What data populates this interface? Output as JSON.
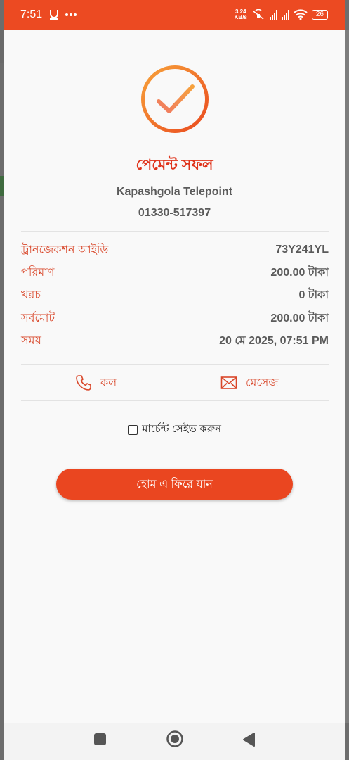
{
  "status_bar": {
    "time": "7:51",
    "left_icons": [
      "usb-icon",
      "more-dots-icon"
    ],
    "speed_value": "3.24",
    "speed_unit": "KB/s",
    "battery": "26"
  },
  "payment": {
    "title": "পেমেন্ট সফল",
    "merchant_name": "Kapashgola Telepoint",
    "merchant_phone": "01330-517397"
  },
  "details": [
    {
      "label": "ট্রানজেকশন আইডি",
      "value": "73Y241YL"
    },
    {
      "label": "পরিমাণ",
      "value": "200.00 টাকা"
    },
    {
      "label": "খরচ",
      "value": "0 টাকা"
    },
    {
      "label": "সর্বমোট",
      "value": "200.00 টাকা"
    },
    {
      "label": "সময়",
      "value": "20 মে 2025, 07:51 PM"
    }
  ],
  "actions": {
    "call_label": "কল",
    "message_label": "মেসেজ"
  },
  "save_merchant": {
    "label": "মার্চেন্ট সেইভ করুন",
    "checked": false
  },
  "home_button_label": "হোম এ ফিরে যান",
  "colors": {
    "accent": "#ec4a22",
    "label": "#d9472a",
    "value": "#5a5a5a",
    "check_gradient_start": "#f7a23a",
    "check_gradient_end": "#ea4a1f"
  }
}
